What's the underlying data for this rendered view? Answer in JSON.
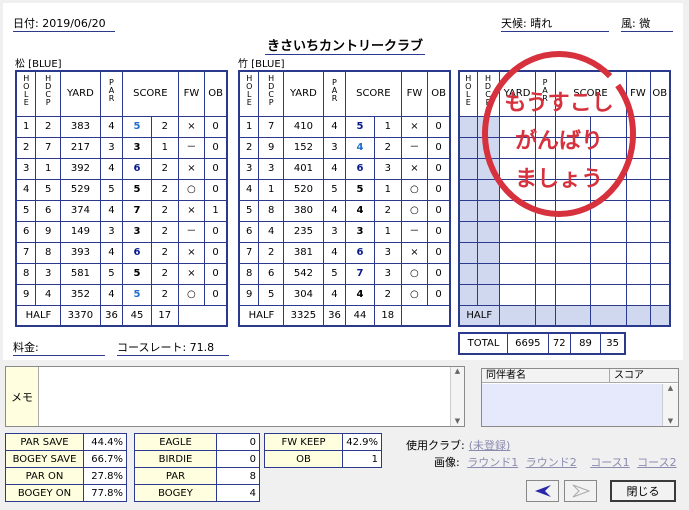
{
  "header": {
    "date_label": "日付: 2019/06/20",
    "weather_label": "天候: 晴れ",
    "wind_label": "風: 微",
    "title": "きさいちカントリークラブ"
  },
  "columns": {
    "hole": "HOLE",
    "hdcp": "HDCP",
    "yard": "YARD",
    "par": "PAR",
    "score": "SCORE",
    "fw": "FW",
    "ob": "OB"
  },
  "course1": {
    "label": "松 [BLUE]",
    "rows": [
      {
        "hole": "1",
        "hdcp": "2",
        "yard": "383",
        "par": "4",
        "score": "5",
        "putt": "2",
        "fw": "×",
        "ob": "0",
        "color": "blue"
      },
      {
        "hole": "2",
        "hdcp": "7",
        "yard": "217",
        "par": "3",
        "score": "3",
        "putt": "1",
        "fw": "－",
        "ob": "0",
        "color": "black"
      },
      {
        "hole": "3",
        "hdcp": "1",
        "yard": "392",
        "par": "4",
        "score": "6",
        "putt": "2",
        "fw": "×",
        "ob": "0",
        "color": "bold"
      },
      {
        "hole": "4",
        "hdcp": "5",
        "yard": "529",
        "par": "5",
        "score": "5",
        "putt": "2",
        "fw": "○",
        "ob": "0",
        "color": "black"
      },
      {
        "hole": "5",
        "hdcp": "6",
        "yard": "374",
        "par": "4",
        "score": "7",
        "putt": "2",
        "fw": "×",
        "ob": "1",
        "color": "black"
      },
      {
        "hole": "6",
        "hdcp": "9",
        "yard": "149",
        "par": "3",
        "score": "3",
        "putt": "2",
        "fw": "－",
        "ob": "0",
        "color": "black"
      },
      {
        "hole": "7",
        "hdcp": "8",
        "yard": "393",
        "par": "4",
        "score": "6",
        "putt": "2",
        "fw": "×",
        "ob": "0",
        "color": "bold"
      },
      {
        "hole": "8",
        "hdcp": "3",
        "yard": "581",
        "par": "5",
        "score": "5",
        "putt": "2",
        "fw": "×",
        "ob": "0",
        "color": "black"
      },
      {
        "hole": "9",
        "hdcp": "4",
        "yard": "352",
        "par": "4",
        "score": "5",
        "putt": "2",
        "fw": "○",
        "ob": "0",
        "color": "blue"
      }
    ],
    "half": {
      "label": "HALF",
      "yard": "3370",
      "par": "36",
      "score": "45",
      "putt": "17"
    }
  },
  "course2": {
    "label": "竹 [BLUE]",
    "rows": [
      {
        "hole": "1",
        "hdcp": "7",
        "yard": "410",
        "par": "4",
        "score": "5",
        "putt": "1",
        "fw": "×",
        "ob": "0",
        "color": "bold"
      },
      {
        "hole": "2",
        "hdcp": "9",
        "yard": "152",
        "par": "3",
        "score": "4",
        "putt": "2",
        "fw": "－",
        "ob": "0",
        "color": "blue"
      },
      {
        "hole": "3",
        "hdcp": "3",
        "yard": "401",
        "par": "4",
        "score": "6",
        "putt": "3",
        "fw": "×",
        "ob": "0",
        "color": "bold"
      },
      {
        "hole": "4",
        "hdcp": "1",
        "yard": "520",
        "par": "5",
        "score": "5",
        "putt": "1",
        "fw": "○",
        "ob": "0",
        "color": "black"
      },
      {
        "hole": "5",
        "hdcp": "8",
        "yard": "380",
        "par": "4",
        "score": "4",
        "putt": "2",
        "fw": "○",
        "ob": "0",
        "color": "black"
      },
      {
        "hole": "6",
        "hdcp": "4",
        "yard": "235",
        "par": "3",
        "score": "3",
        "putt": "1",
        "fw": "－",
        "ob": "0",
        "color": "black"
      },
      {
        "hole": "7",
        "hdcp": "2",
        "yard": "381",
        "par": "4",
        "score": "6",
        "putt": "3",
        "fw": "×",
        "ob": "0",
        "color": "bold"
      },
      {
        "hole": "8",
        "hdcp": "6",
        "yard": "542",
        "par": "5",
        "score": "7",
        "putt": "3",
        "fw": "○",
        "ob": "0",
        "color": "bold"
      },
      {
        "hole": "9",
        "hdcp": "5",
        "yard": "304",
        "par": "4",
        "score": "4",
        "putt": "2",
        "fw": "○",
        "ob": "0",
        "color": "black"
      }
    ],
    "half": {
      "label": "HALF",
      "yard": "3325",
      "par": "36",
      "score": "44",
      "putt": "18"
    }
  },
  "course3": {
    "half": {
      "label": "HALF"
    },
    "total": {
      "label": "TOTAL",
      "yard": "6695",
      "par": "72",
      "score": "89",
      "putt": "35"
    }
  },
  "stamp": {
    "lines": [
      "もうすこし",
      "がんばり",
      "ましょう"
    ],
    "color": "#d6313d"
  },
  "fee_label": "料金:",
  "course_rate_label": "コースレート:",
  "course_rate_value": "71.8",
  "memo_label": "メモ",
  "companions": {
    "col_name": "同伴者名",
    "col_score": "スコア"
  },
  "stats": {
    "rates": [
      {
        "label": "PAR SAVE",
        "value": "44.4%"
      },
      {
        "label": "BOGEY SAVE",
        "value": "66.7%"
      },
      {
        "label": "PAR ON",
        "value": "27.8%"
      },
      {
        "label": "BOGEY ON",
        "value": "77.8%"
      }
    ],
    "counts": [
      {
        "label": "EAGLE",
        "value": "0"
      },
      {
        "label": "BIRDIE",
        "value": "0"
      },
      {
        "label": "PAR",
        "value": "8"
      },
      {
        "label": "BOGEY",
        "value": "4"
      }
    ],
    "extra": [
      {
        "label": "FW KEEP",
        "value": "42.9%"
      },
      {
        "label": "OB",
        "value": "1"
      }
    ]
  },
  "club_label": "使用クラブ:",
  "club_link": "(未登録)",
  "image_label": "画像:",
  "image_links": [
    "ラウンド1",
    "ラウンド2",
    "コース1",
    "コース2"
  ],
  "buttons": {
    "close": "閉じる"
  },
  "colors": {
    "grid": "#2b3a8c",
    "shade": "#cfd8ef",
    "score_blue": "#1f6fd0"
  }
}
